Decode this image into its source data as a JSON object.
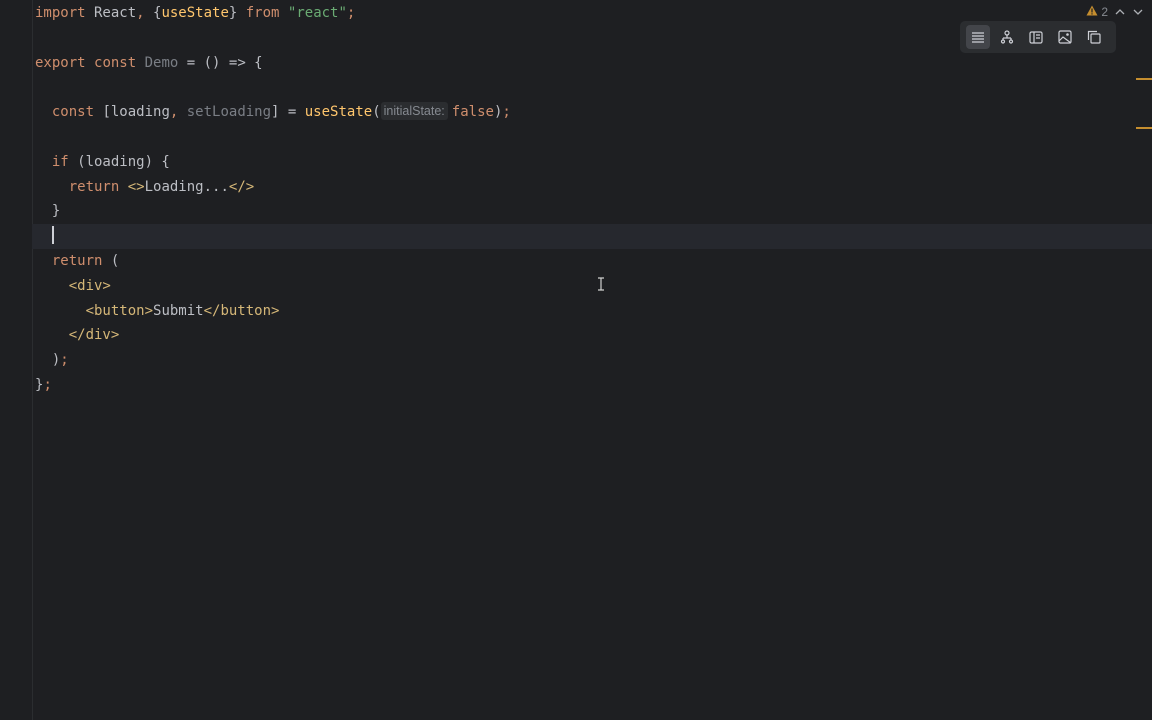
{
  "editor": {
    "code_lines": [
      {
        "tokens": [
          {
            "t": "import",
            "c": "kw"
          },
          {
            "t": " React",
            "c": "plain"
          },
          {
            "t": ",",
            "c": "kw"
          },
          {
            "t": " {",
            "c": "plain"
          },
          {
            "t": "useState",
            "c": "hl-fn"
          },
          {
            "t": "} ",
            "c": "plain"
          },
          {
            "t": "from",
            "c": "kw"
          },
          {
            "t": " ",
            "c": "plain"
          },
          {
            "t": "\"react\"",
            "c": "str"
          },
          {
            "t": ";",
            "c": "kw"
          }
        ]
      },
      {
        "tokens": []
      },
      {
        "tokens": [
          {
            "t": "export",
            "c": "kw"
          },
          {
            "t": " ",
            "c": "plain"
          },
          {
            "t": "const",
            "c": "kw"
          },
          {
            "t": " ",
            "c": "plain"
          },
          {
            "t": "Demo",
            "c": "gray"
          },
          {
            "t": " = () => {",
            "c": "plain"
          }
        ]
      },
      {
        "tokens": []
      },
      {
        "tokens": [
          {
            "t": "  ",
            "c": "plain"
          },
          {
            "t": "const",
            "c": "kw"
          },
          {
            "t": " [loading",
            "c": "plain"
          },
          {
            "t": ",",
            "c": "kw"
          },
          {
            "t": " setLoading",
            "c": "gray"
          },
          {
            "t": "] = ",
            "c": "plain"
          },
          {
            "t": "useState",
            "c": "hl-fn"
          },
          {
            "t": "(",
            "c": "plain"
          },
          {
            "t": "initialState:",
            "c": "hint"
          },
          {
            "t": "false",
            "c": "kw"
          },
          {
            "t": ")",
            "c": "plain"
          },
          {
            "t": ";",
            "c": "kw"
          }
        ]
      },
      {
        "tokens": []
      },
      {
        "tokens": [
          {
            "t": "  ",
            "c": "plain"
          },
          {
            "t": "if",
            "c": "kw"
          },
          {
            "t": " (loading) {",
            "c": "plain"
          }
        ]
      },
      {
        "tokens": [
          {
            "t": "    ",
            "c": "plain"
          },
          {
            "t": "return",
            "c": "kw"
          },
          {
            "t": " ",
            "c": "plain"
          },
          {
            "t": "<>",
            "c": "tag"
          },
          {
            "t": "Loading...",
            "c": "plain"
          },
          {
            "t": "</>",
            "c": "tag"
          }
        ]
      },
      {
        "tokens": [
          {
            "t": "  }",
            "c": "plain"
          }
        ]
      },
      {
        "tokens": [],
        "current": true
      },
      {
        "tokens": [
          {
            "t": "  ",
            "c": "plain"
          },
          {
            "t": "return",
            "c": "kw"
          },
          {
            "t": " (",
            "c": "plain"
          }
        ]
      },
      {
        "tokens": [
          {
            "t": "    ",
            "c": "plain"
          },
          {
            "t": "<div>",
            "c": "tag"
          }
        ]
      },
      {
        "tokens": [
          {
            "t": "      ",
            "c": "plain"
          },
          {
            "t": "<button>",
            "c": "tag"
          },
          {
            "t": "Submit",
            "c": "plain"
          },
          {
            "t": "</button>",
            "c": "tag"
          }
        ]
      },
      {
        "tokens": [
          {
            "t": "    ",
            "c": "plain"
          },
          {
            "t": "</div>",
            "c": "tag"
          }
        ]
      },
      {
        "tokens": [
          {
            "t": "  )",
            "c": "plain"
          },
          {
            "t": ";",
            "c": "kw"
          }
        ]
      },
      {
        "tokens": [
          {
            "t": "}",
            "c": "plain"
          },
          {
            "t": ";",
            "c": "kw"
          }
        ]
      }
    ]
  },
  "inspection": {
    "warning_icon": "warning-triangle-icon",
    "warning_count": "2"
  },
  "toolbar": {
    "buttons": [
      {
        "icon": "reader-mode-icon",
        "active": true
      },
      {
        "icon": "structure-icon",
        "active": false
      },
      {
        "icon": "preview-panel-icon",
        "active": false
      },
      {
        "icon": "image-preview-icon",
        "active": false
      },
      {
        "icon": "copy-window-icon",
        "active": false
      }
    ]
  },
  "colors": {
    "background": "#1e1f22",
    "keyword": "#cf8e6d",
    "function": "#ffc66d",
    "string": "#6aab73",
    "tag": "#d5b778",
    "warning": "#c58e2f"
  }
}
